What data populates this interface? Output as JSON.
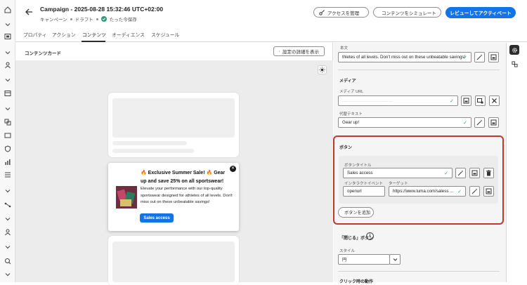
{
  "header": {
    "title": "Campaign - 2025-08-28 15:32:46 UTC+02:00",
    "crumb_campaign": "キャンペーン",
    "crumb_status": "ドラフト",
    "crumb_saved": "たった今保存",
    "manage_access": "アクセスを管理",
    "simulate": "コンテンツをシミュレート",
    "review_activate": "レビューしてアクティベート"
  },
  "tabs": [
    "プロパティ",
    "アクション",
    "コンテンツ",
    "オーディエンス",
    "スケジュール"
  ],
  "active_tab": "コンテンツ",
  "left": {
    "title": "コンテンツカード",
    "show_details": "設定の詳細を表示"
  },
  "popup": {
    "headline": "🔥 Exclusive Summer Sale! 🔥 Gear up and save 25% on all sportswear!",
    "body": "Elevate your performance with our top-quality sportswear designed for athletes of all levels. Don't miss out on these unbeatable savings!",
    "button": "Sales access",
    "close": "✕"
  },
  "right": {
    "body_label": "本文",
    "body_value": "thletes of all levels. Don't miss out on these unbeatable savings!",
    "media_section": "メディア",
    "media_url_label": "メディア URL",
    "media_url_value": "..........................................",
    "alt_label": "代替テキスト",
    "alt_value": "Gear up!",
    "buttons_section": "ボタン",
    "button_title_label": "ボタンタイトル",
    "button_title_value": "Sales access",
    "interaction_label": "インタラクトイベント",
    "interaction_value": "openurl",
    "target_label": "ターゲット",
    "target_value": "https://www.luma.com/saless ...",
    "add_button": "ボタンを追加",
    "close_section": "「閉じる」ボタン",
    "style_label": "スタイル",
    "style_value": "円",
    "click_section": "クリック時の動作"
  },
  "colors": {
    "accent": "#1473e6",
    "highlight": "#c0392b",
    "success": "#2d9d78"
  }
}
